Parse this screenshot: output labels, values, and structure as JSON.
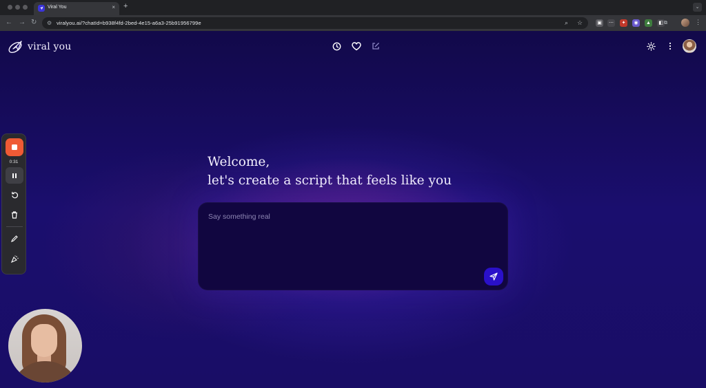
{
  "browser": {
    "tab_title": "Viral You",
    "tab_close": "×",
    "new_tab": "+",
    "url": "viralyou.ai/?chatId=b938f4fd-2bed-4e15-a6a3-25b91956799e"
  },
  "app": {
    "brand_name": "viral you",
    "header_icons": [
      "history-icon",
      "heart-icon",
      "edit-icon"
    ],
    "right_icons": [
      "sun-icon",
      "more-vertical-icon"
    ]
  },
  "main": {
    "welcome_line1": "Welcome,",
    "welcome_line2": "let's create a script that feels like you",
    "composer_placeholder": "Say something real"
  },
  "recorder": {
    "elapsed": "0:31",
    "stop_color": "#ef5a35"
  },
  "colors": {
    "accent": "#2a10c9",
    "background": "#1a0e6e",
    "composer": "#110640"
  }
}
